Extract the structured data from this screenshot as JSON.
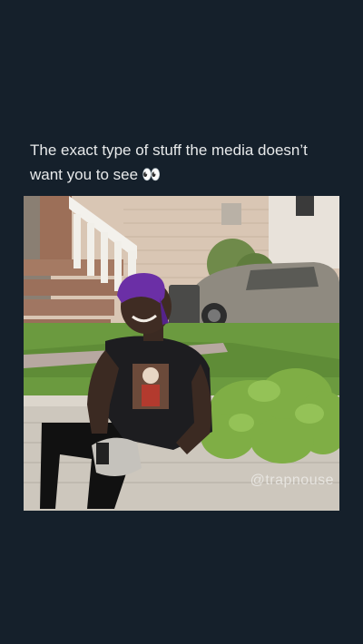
{
  "post": {
    "caption": "The exact type of stuff the media doesn’t want you to see",
    "caption_emoji": "👀"
  },
  "media": {
    "watermark": "@trapnouse"
  },
  "colors": {
    "background": "#15202b",
    "text": "#e7e9ea"
  }
}
